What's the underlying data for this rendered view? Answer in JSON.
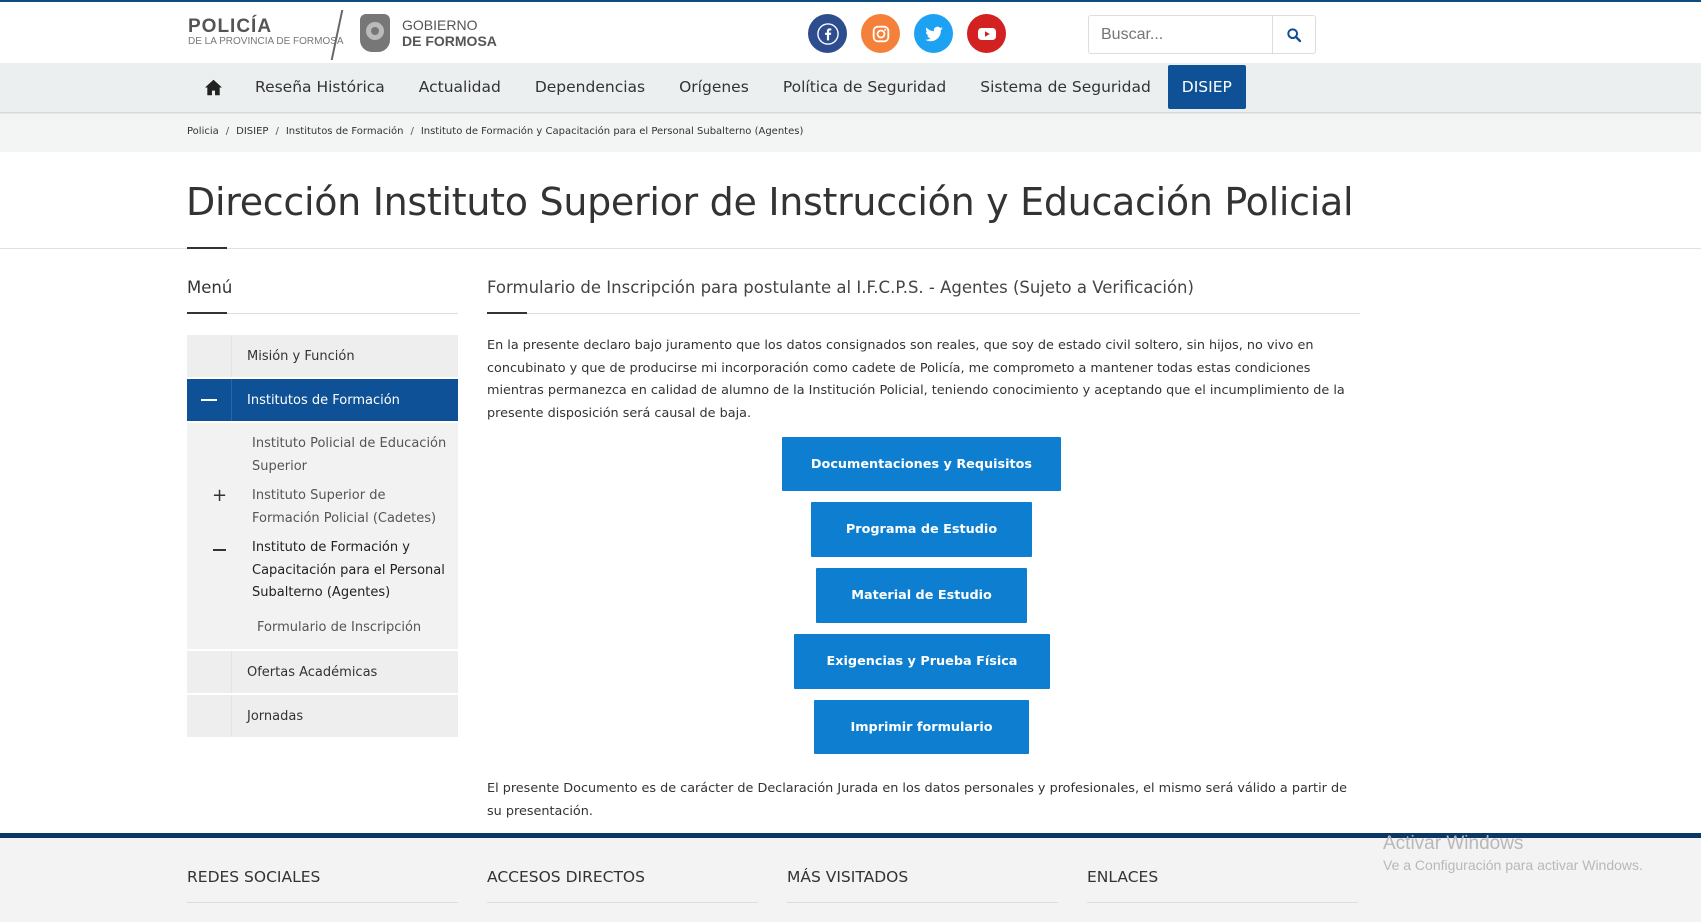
{
  "header": {
    "logo_line1": "POLICÍA",
    "logo_line2": "DE LA PROVINCIA DE FORMOSA",
    "gov_line1": "GOBIERNO",
    "gov_line2": "DE FORMOSA",
    "search_placeholder": "Buscar..."
  },
  "social_icons": [
    "facebook-icon",
    "instagram-icon",
    "twitter-icon",
    "youtube-icon"
  ],
  "colors": {
    "primary": "#0f5196",
    "button": "#0e7fd0",
    "footer_bar": "#0a3766",
    "facebook": "#2d4d8f",
    "instagram": "#f4803a",
    "twitter": "#1da1f2",
    "youtube": "#d32121"
  },
  "nav": {
    "items": [
      "Reseña Histórica",
      "Actualidad",
      "Dependencias",
      "Orígenes",
      "Política de Seguridad",
      "Sistema de Seguridad",
      "DISIEP"
    ],
    "active": "DISIEP"
  },
  "breadcrumb": [
    "Policia",
    "DISIEP",
    "Institutos de Formación",
    "Instituto de Formación y Capacitación para el Personal Subalterno (Agentes)"
  ],
  "page_title": "Dirección Instituto Superior de Instrucción y Educación Policial",
  "sidebar": {
    "heading": "Menú",
    "items": [
      {
        "label": "Misión y Función"
      },
      {
        "label": "Institutos de Formación"
      },
      {
        "label": "Ofertas Académicas"
      },
      {
        "label": "Jornadas"
      }
    ],
    "sub_items": [
      {
        "label": "Instituto Policial de Educación Superior"
      },
      {
        "label": "Instituto Superior de Formación Policial (Cadetes)"
      },
      {
        "label": "Instituto de Formación y Capacitación para el Personal Subalterno (Agentes)"
      },
      {
        "label": "Formulario de Inscripción"
      }
    ]
  },
  "main": {
    "heading": "Formulario de Inscripción para postulante al I.F.C.P.S. - Agentes (Sujeto a Verificación)",
    "paragraph": "En la presente declaro bajo juramento que los datos consignados son reales, que soy de estado civil soltero, sin hijos, no vivo en concubinato y que de producirse mi incorporación como cadete de Policía, me comprometo a mantener todas estas condiciones mientras permanezca en calidad de alumno de la Institución Policial, teniendo conocimiento y aceptando que el incumplimiento de la presente disposición será causal de baja.",
    "buttons": [
      "Documentaciones y Requisitos",
      "Programa de Estudio",
      "Material de Estudio",
      "Exigencias y Prueba Física",
      "Imprimir formulario"
    ],
    "footer_note": "El presente Documento es de carácter de Declaración Jurada en los datos personales y profesionales, el mismo será válido a partir de su presentación."
  },
  "footer": {
    "columns": [
      "REDES SOCIALES",
      "ACCESOS DIRECTOS",
      "MÁS VISITADOS",
      "ENLACES"
    ]
  },
  "watermark": {
    "line1": "Activar Windows",
    "line2": "Ve a Configuración para activar Windows."
  }
}
